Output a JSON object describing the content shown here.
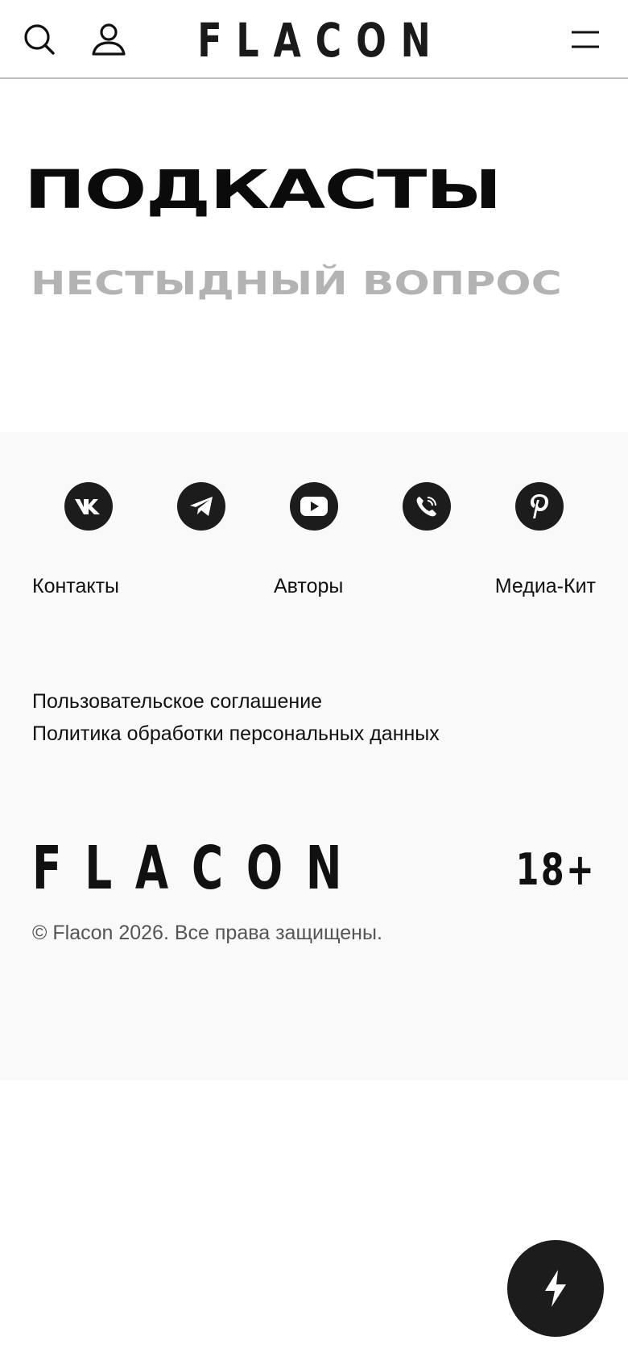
{
  "header": {
    "logo": "FLACON",
    "icons": [
      "search-icon",
      "user-icon",
      "menu-icon"
    ]
  },
  "main": {
    "title": "ПОДКАСТЫ",
    "podcasts": [
      "НЕСТЫДНЫЙ ВОПРОС"
    ]
  },
  "footer": {
    "social_icons": [
      "vk-icon",
      "telegram-icon",
      "youtube-icon",
      "viber-icon",
      "pinterest-icon"
    ],
    "links": {
      "contacts": "Контакты",
      "authors": "Авторы",
      "media_kit": "Медиа-Кит"
    },
    "legal": {
      "agreement": "Пользовательское соглашение",
      "privacy": "Политика обработки персональных данных"
    },
    "logo": "FLACON",
    "age_rating": "18+",
    "copyright": "© Flacon 2026. Все права защищены."
  },
  "fab": {
    "icon": "lightning-icon"
  },
  "colors": {
    "text": "#111111",
    "muted_title": "#b3b3b3",
    "footer_bg": "#f9f9f9",
    "icon_bg": "#1c1c1c"
  }
}
